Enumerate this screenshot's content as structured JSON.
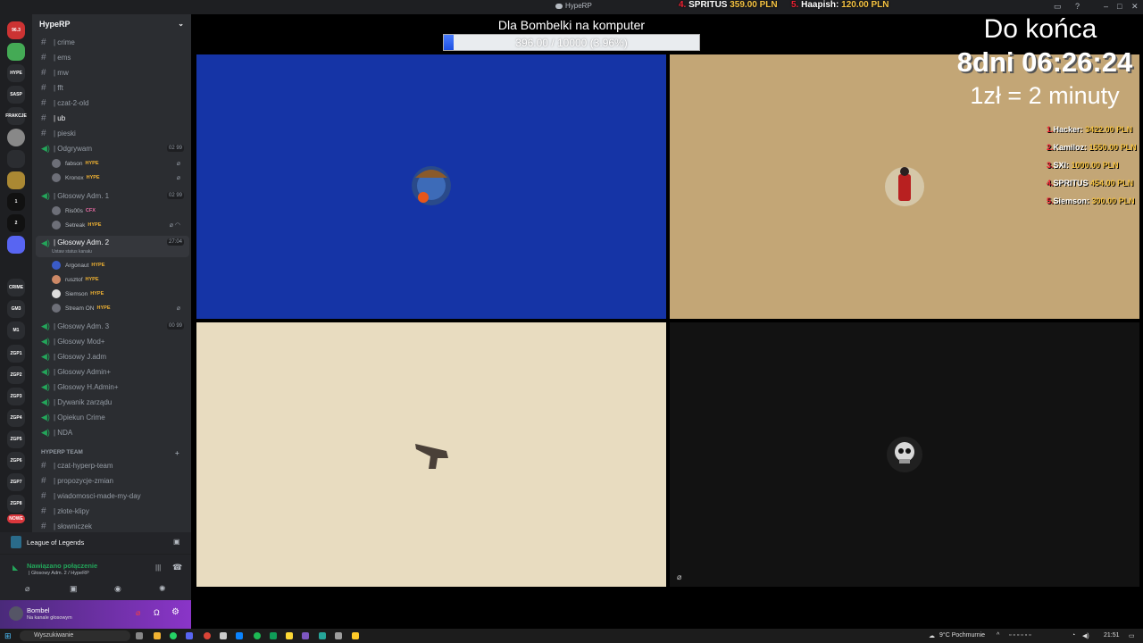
{
  "window": {
    "title": "HypeRP"
  },
  "donors_top": [
    {
      "rank": "4.",
      "name": "SPRITUS",
      "amount": "359.00 PLN"
    },
    {
      "rank": "5.",
      "name": "Haapish:",
      "amount": "120.00 PLN"
    }
  ],
  "server": {
    "name": "HypeRP"
  },
  "rail_servers": [
    "96.3",
    "",
    "HYPE",
    "SASP",
    "FRAKCJE",
    "",
    "",
    "",
    "1",
    "2",
    "",
    "CRIME",
    "GM3",
    "M1",
    "ZGP1",
    "ZGP2",
    "ZGP3",
    "ZGP4",
    "ZGP5",
    "ZGP6",
    "ZGP7",
    "ZGP8",
    "NOWE"
  ],
  "channels": [
    {
      "type": "text",
      "name": "| crime"
    },
    {
      "type": "text",
      "name": "| ems"
    },
    {
      "type": "text",
      "name": "| mw"
    },
    {
      "type": "text",
      "name": "| fft"
    },
    {
      "type": "text",
      "name": "| czat-2-old"
    },
    {
      "type": "text",
      "name": "| ub"
    },
    {
      "type": "text",
      "name": "| pieski"
    }
  ],
  "voice_channels": [
    {
      "name": "| Odgrywam",
      "badge": "02 99",
      "users": [
        {
          "name": "fabson",
          "tag": "HYPE"
        },
        {
          "name": "Kronox",
          "tag": "HYPE"
        }
      ]
    },
    {
      "name": "| Głosowy Adm. 1",
      "badge": "02 99",
      "users": [
        {
          "name": "Ris00s",
          "tag": "CFX"
        },
        {
          "name": "Setreak",
          "tag": "HYPE"
        }
      ]
    },
    {
      "name": "| Głosowy Adm. 2",
      "badge": "27:04",
      "status": "Ustaw status kanału",
      "users": [
        {
          "name": "Argonaut",
          "tag": "HYPE"
        },
        {
          "name": "rusztof",
          "tag": "HYPE"
        },
        {
          "name": "Siemson",
          "tag": "HYPE"
        },
        {
          "name": "Stream ON",
          "tag": "HYPE"
        }
      ]
    }
  ],
  "voice_channels_2": [
    {
      "name": "| Głosowy Adm. 3",
      "badge": "00 99"
    },
    {
      "name": "| Głosowy Mod+"
    },
    {
      "name": "| Głosowy J.adm"
    },
    {
      "name": "| Głosowy Admin+"
    },
    {
      "name": "| Głosowy H.Admin+"
    },
    {
      "name": "| Dywanik zarządu"
    },
    {
      "name": "| Opiekun Crime"
    },
    {
      "name": "| NDA"
    }
  ],
  "category": {
    "name": "HYPERP TEAM"
  },
  "team_channels": [
    "| czat-hyperp-team",
    "| propozycje-zmian",
    "| wiadomosci-made-my-day",
    "| złote-klipy",
    "| słowniczek"
  ],
  "activity": {
    "game": "League of Legends"
  },
  "voice_status": {
    "title": "Nawiązano połączenie",
    "subtitle": "| Głosowy Adm. 2 / HypeRP"
  },
  "user": {
    "name": "Bombel",
    "status": "Na kanale głosowym"
  },
  "goal": {
    "title": "Dla Bombelki na komputer",
    "text": "396.00 / 10000 (3.96%)",
    "progress": 0.0396
  },
  "timer": {
    "title": "Do końca",
    "value": "8dni 06:26:24",
    "rate": "1zł = 2 minuty"
  },
  "leaderboard": [
    {
      "rank": "1.",
      "name": "Hacker:",
      "amount": "3422.00 PLN"
    },
    {
      "rank": "2.",
      "name": "Kamiloz:",
      "amount": "1550.00 PLN"
    },
    {
      "rank": "3.",
      "name": "SXI:",
      "amount": "1000.00 PLN"
    },
    {
      "rank": "4.",
      "name": "SPRITUS",
      "amount": "454.00 PLN"
    },
    {
      "rank": "5.",
      "name": "Siemson:",
      "amount": "300.00 PLN"
    }
  ],
  "tiles": [
    {
      "name": "tile-blue",
      "bg": "#1534a6"
    },
    {
      "name": "tile-tan",
      "bg": "#c3a676"
    },
    {
      "name": "tile-cream",
      "bg": "#e8dcc0"
    },
    {
      "name": "tile-dark",
      "bg": "#121212"
    }
  ],
  "taskbar": {
    "search": "Wyszukiwanie",
    "weather": "9°C Pochmurnie",
    "time": "21:51"
  }
}
